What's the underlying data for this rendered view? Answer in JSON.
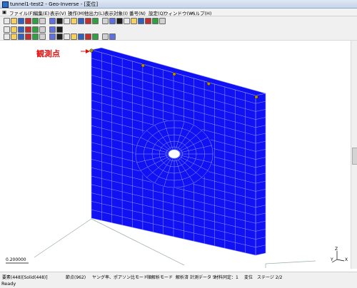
{
  "window": {
    "title": "tunnel1-test2 - Geo-Inverse - [変位]"
  },
  "menu": [
    "ファイル(F)",
    "編集(E)",
    "表示(V)",
    "操作(M)",
    "他出力(L)",
    "表示対象(I)",
    "番号(N)",
    "設定(Q)",
    "ウィンドウ(W)",
    "ヘルプ(H)"
  ],
  "toolbar_icons": {
    "row1": [
      "new-icon",
      "open-icon",
      "save-icon",
      "print-icon",
      "preview-icon",
      "copy-icon",
      "paste-icon",
      "zoom-icon",
      "pointer-icon",
      "cut-icon",
      "prev-icon",
      "next-icon",
      "step-icon",
      "rewind-icon",
      "forward-icon",
      "run-icon",
      "stop-icon",
      "graph-icon",
      "settings-icon",
      "window-icon",
      "pin-icon",
      "check-icon"
    ],
    "row2": [
      "model-icon",
      "solid-icon",
      "mesh-icon",
      "beam-icon",
      "shell-icon",
      "layer-icon",
      "node-icon",
      "element-icon"
    ],
    "row3": [
      "fit-icon",
      "pan-icon",
      "rotate-icon",
      "zoom-in-icon",
      "zoom-out-icon",
      "zoom-window-icon",
      "rubber-icon",
      "color-icon",
      "red-icon",
      "white-icon",
      "cube-icon",
      "lines-icon",
      "palette-icon",
      "refresh-icon",
      "grid-icon"
    ]
  },
  "viewport": {
    "observation_label": "観測点",
    "scale_value": "0.200000",
    "axes": {
      "z": "Z",
      "x": "X",
      "y": "Y"
    }
  },
  "status": [
    "要素(448)[Solid(448)]",
    "節点(962)",
    "ヤング率、ポアソン比モード",
    "順解析モード",
    "解析済",
    "計測データ 5",
    "材料同定：1",
    "変位",
    "ステージ 2/2"
  ],
  "ready_text": "Ready",
  "colors": {
    "mesh_fill": "#1111f4",
    "mesh_line": "#8fa0ff",
    "annotation": "#e01010",
    "marker": "#b09000"
  }
}
